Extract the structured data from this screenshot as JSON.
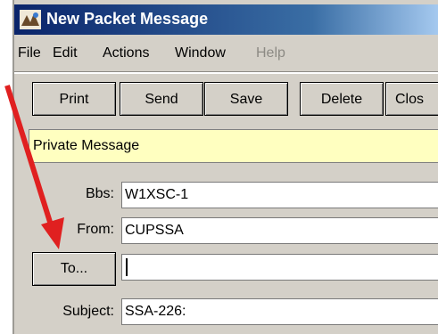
{
  "window": {
    "title": "New Packet Message"
  },
  "menubar": [
    {
      "label": "File",
      "enabled": true
    },
    {
      "label": "Edit",
      "enabled": true
    },
    {
      "label": "Actions",
      "enabled": true
    },
    {
      "label": "Window",
      "enabled": true
    },
    {
      "label": "Help",
      "enabled": false
    }
  ],
  "toolbar": {
    "print": "Print",
    "send": "Send",
    "save": "Save",
    "delete": "Delete",
    "close": "Clos"
  },
  "banner": "Private Message",
  "form": {
    "bbs": {
      "label": "Bbs:",
      "value": "W1XSC-1"
    },
    "from": {
      "label": "From:",
      "value": "CUPSSA"
    },
    "to": {
      "label": "To...",
      "value": ""
    },
    "subject": {
      "label": "Subject:",
      "value": "SSA-226:"
    }
  },
  "colors": {
    "banner": "#ffffc0",
    "arrow": "#e02020",
    "titlebar": "#0a246a"
  }
}
